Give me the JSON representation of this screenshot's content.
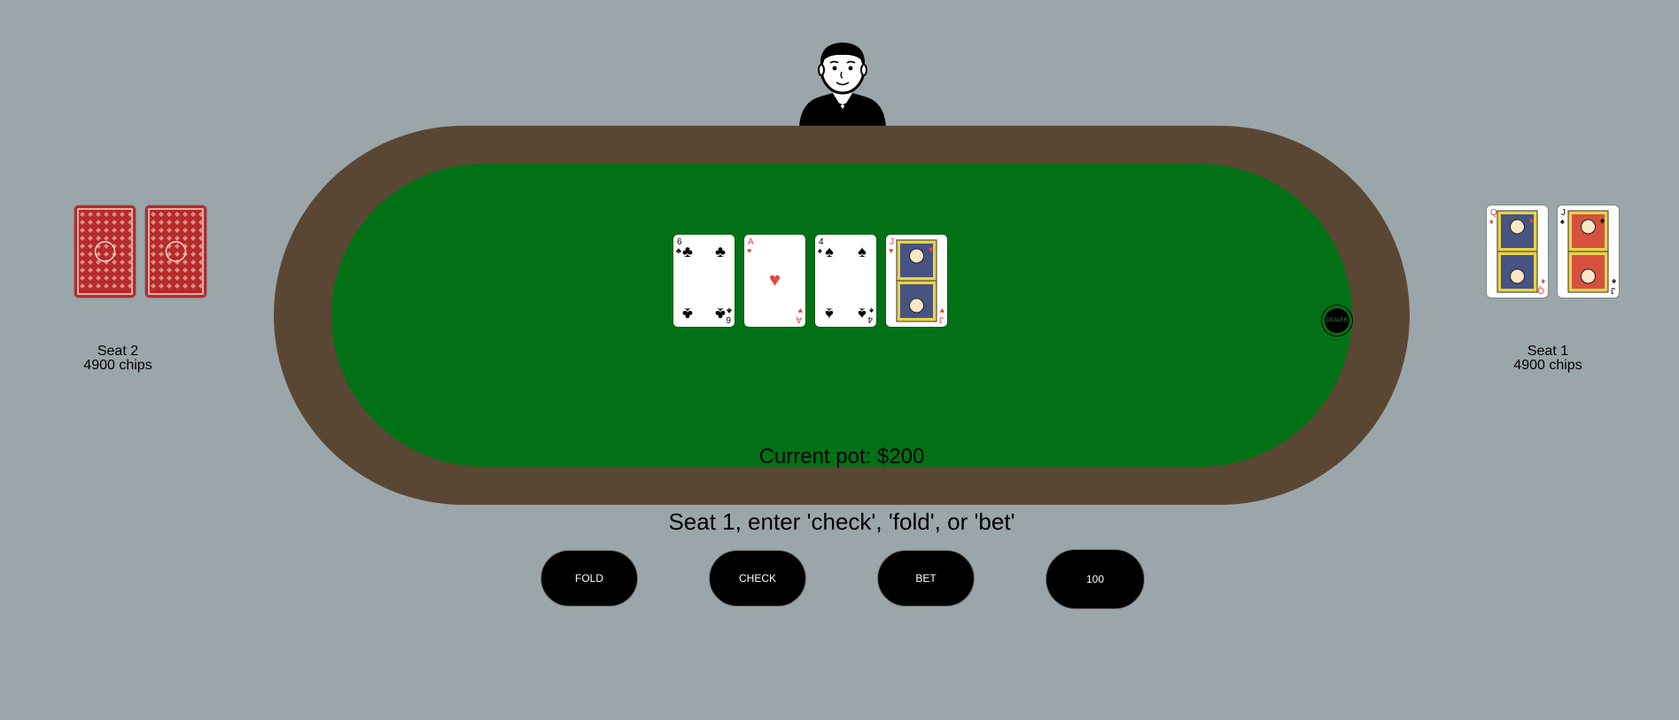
{
  "dealer": {
    "chip_label": "DEALER"
  },
  "board": {
    "cards": [
      {
        "rank": "6",
        "suit": "clubs",
        "suit_glyph": "♣",
        "color": "#000000"
      },
      {
        "rank": "A",
        "suit": "hearts",
        "suit_glyph": "♥",
        "color": "#e8443d"
      },
      {
        "rank": "4",
        "suit": "spades",
        "suit_glyph": "♠",
        "color": "#000000"
      },
      {
        "rank": "J",
        "suit": "hearts",
        "suit_glyph": "♥",
        "color": "#e8443d"
      }
    ]
  },
  "seats": [
    {
      "name": "Seat 2",
      "chips": "4900 chips",
      "cards": [
        {
          "face": "back"
        },
        {
          "face": "back"
        }
      ]
    },
    {
      "name": "Seat 1",
      "chips": "4900 chips",
      "cards": [
        {
          "face": "up",
          "rank": "Q",
          "suit": "diamonds",
          "suit_glyph": "♦",
          "color": "#e8443d"
        },
        {
          "face": "up",
          "rank": "J",
          "suit": "spades",
          "suit_glyph": "♠",
          "color": "#000000"
        }
      ]
    }
  ],
  "pot": {
    "text": "Current pot: $200"
  },
  "prompt": {
    "text": "Seat 1, enter 'check', 'fold', or 'bet'"
  },
  "actions": {
    "fold": "FOLD",
    "check": "CHECK",
    "bet": "BET",
    "amount": "100"
  },
  "colors": {
    "felt": "#027116",
    "rail": "#5a4733",
    "background": "#9ba6aa",
    "card_back": "#b52a2b"
  }
}
